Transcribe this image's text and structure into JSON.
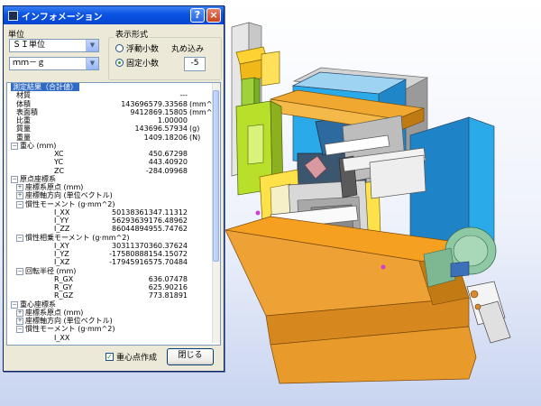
{
  "window": {
    "title": "インフォメーション"
  },
  "units": {
    "label": "単位",
    "system_value": "ＳＩ単位",
    "length_mass_value": "ｍｍ－ｇ"
  },
  "display_format": {
    "label": "表示形式",
    "options": [
      "浮動小数",
      "固定小数"
    ],
    "selected": "固定小数"
  },
  "rounding": {
    "label": "丸め込み",
    "value": "-5"
  },
  "results": {
    "rows": [
      {
        "indent": 0,
        "toggle": "",
        "label": "測定結果（合計値）",
        "value": "",
        "unit": "",
        "selected": true
      },
      {
        "indent": 1,
        "toggle": "",
        "label": "材質",
        "value": "---",
        "unit": ""
      },
      {
        "indent": 1,
        "toggle": "",
        "label": "体積",
        "value": "143696579.33568",
        "unit": "(mm^3)"
      },
      {
        "indent": 1,
        "toggle": "",
        "label": "表面積",
        "value": "9412869.15805",
        "unit": "(mm^2)"
      },
      {
        "indent": 1,
        "toggle": "",
        "label": "比重",
        "value": "1.00000",
        "unit": ""
      },
      {
        "indent": 1,
        "toggle": "",
        "label": "質量",
        "value": "143696.57934",
        "unit": "(g)"
      },
      {
        "indent": 1,
        "toggle": "",
        "label": "重量",
        "value": "1409.18206",
        "unit": "(N)"
      },
      {
        "indent": 0,
        "toggle": "−",
        "label": "重心 (mm)",
        "value": "",
        "unit": ""
      },
      {
        "indent": 3,
        "toggle": "",
        "label": "XC",
        "value": "450.67298",
        "unit": ""
      },
      {
        "indent": 3,
        "toggle": "",
        "label": "YC",
        "value": "443.40920",
        "unit": ""
      },
      {
        "indent": 3,
        "toggle": "",
        "label": "ZC",
        "value": "-284.09968",
        "unit": ""
      },
      {
        "indent": 0,
        "toggle": "−",
        "label": "原点座標系",
        "value": "",
        "unit": ""
      },
      {
        "indent": 1,
        "toggle": "+",
        "label": "座標系原点 (mm)",
        "value": "",
        "unit": ""
      },
      {
        "indent": 1,
        "toggle": "+",
        "label": "座標軸方向 (単位ベクトル)",
        "value": "",
        "unit": ""
      },
      {
        "indent": 1,
        "toggle": "−",
        "label": "慣性モーメント (g·mm^2)",
        "value": "",
        "unit": ""
      },
      {
        "indent": 3,
        "toggle": "",
        "label": "I_XX",
        "value": "50138361347.11312",
        "unit": ""
      },
      {
        "indent": 3,
        "toggle": "",
        "label": "I_YY",
        "value": "56293639176.48962",
        "unit": ""
      },
      {
        "indent": 3,
        "toggle": "",
        "label": "I_ZZ",
        "value": "86044894955.74762",
        "unit": ""
      },
      {
        "indent": 1,
        "toggle": "−",
        "label": "慣性相乗モーメント (g·mm^2)",
        "value": "",
        "unit": ""
      },
      {
        "indent": 3,
        "toggle": "",
        "label": "I_XY",
        "value": "30311370360.37624",
        "unit": ""
      },
      {
        "indent": 3,
        "toggle": "",
        "label": "I_YZ",
        "value": "-17580888154.15072",
        "unit": ""
      },
      {
        "indent": 3,
        "toggle": "",
        "label": "I_XZ",
        "value": "-17945916575.70484",
        "unit": ""
      },
      {
        "indent": 1,
        "toggle": "−",
        "label": "回転半径 (mm)",
        "value": "",
        "unit": ""
      },
      {
        "indent": 3,
        "toggle": "",
        "label": "R_GX",
        "value": "636.07478",
        "unit": ""
      },
      {
        "indent": 3,
        "toggle": "",
        "label": "R_GY",
        "value": "625.90216",
        "unit": ""
      },
      {
        "indent": 3,
        "toggle": "",
        "label": "R_GZ",
        "value": "773.81891",
        "unit": ""
      },
      {
        "indent": 0,
        "toggle": "−",
        "label": "重心座標系",
        "value": "",
        "unit": ""
      },
      {
        "indent": 1,
        "toggle": "+",
        "label": "座標系原点 (mm)",
        "value": "",
        "unit": ""
      },
      {
        "indent": 1,
        "toggle": "+",
        "label": "座標軸方向 (単位ベクトル)",
        "value": "",
        "unit": ""
      },
      {
        "indent": 1,
        "toggle": "−",
        "label": "慣性モーメント (g·mm^2)",
        "value": "",
        "unit": ""
      },
      {
        "indent": 3,
        "toggle": "",
        "label": "I_XX",
        "value": "",
        "unit": ""
      }
    ]
  },
  "footer": {
    "checkbox_label": "重心点作成",
    "checkbox_checked": true,
    "close_label": "閉じる"
  },
  "colors": {
    "titlebar": "#0a53e3",
    "dialog_bg": "#ece9d8",
    "selection": "#316ac5",
    "model_orange": "#f0a830",
    "model_blue": "#2aaae8",
    "model_green": "#b8e02a"
  }
}
